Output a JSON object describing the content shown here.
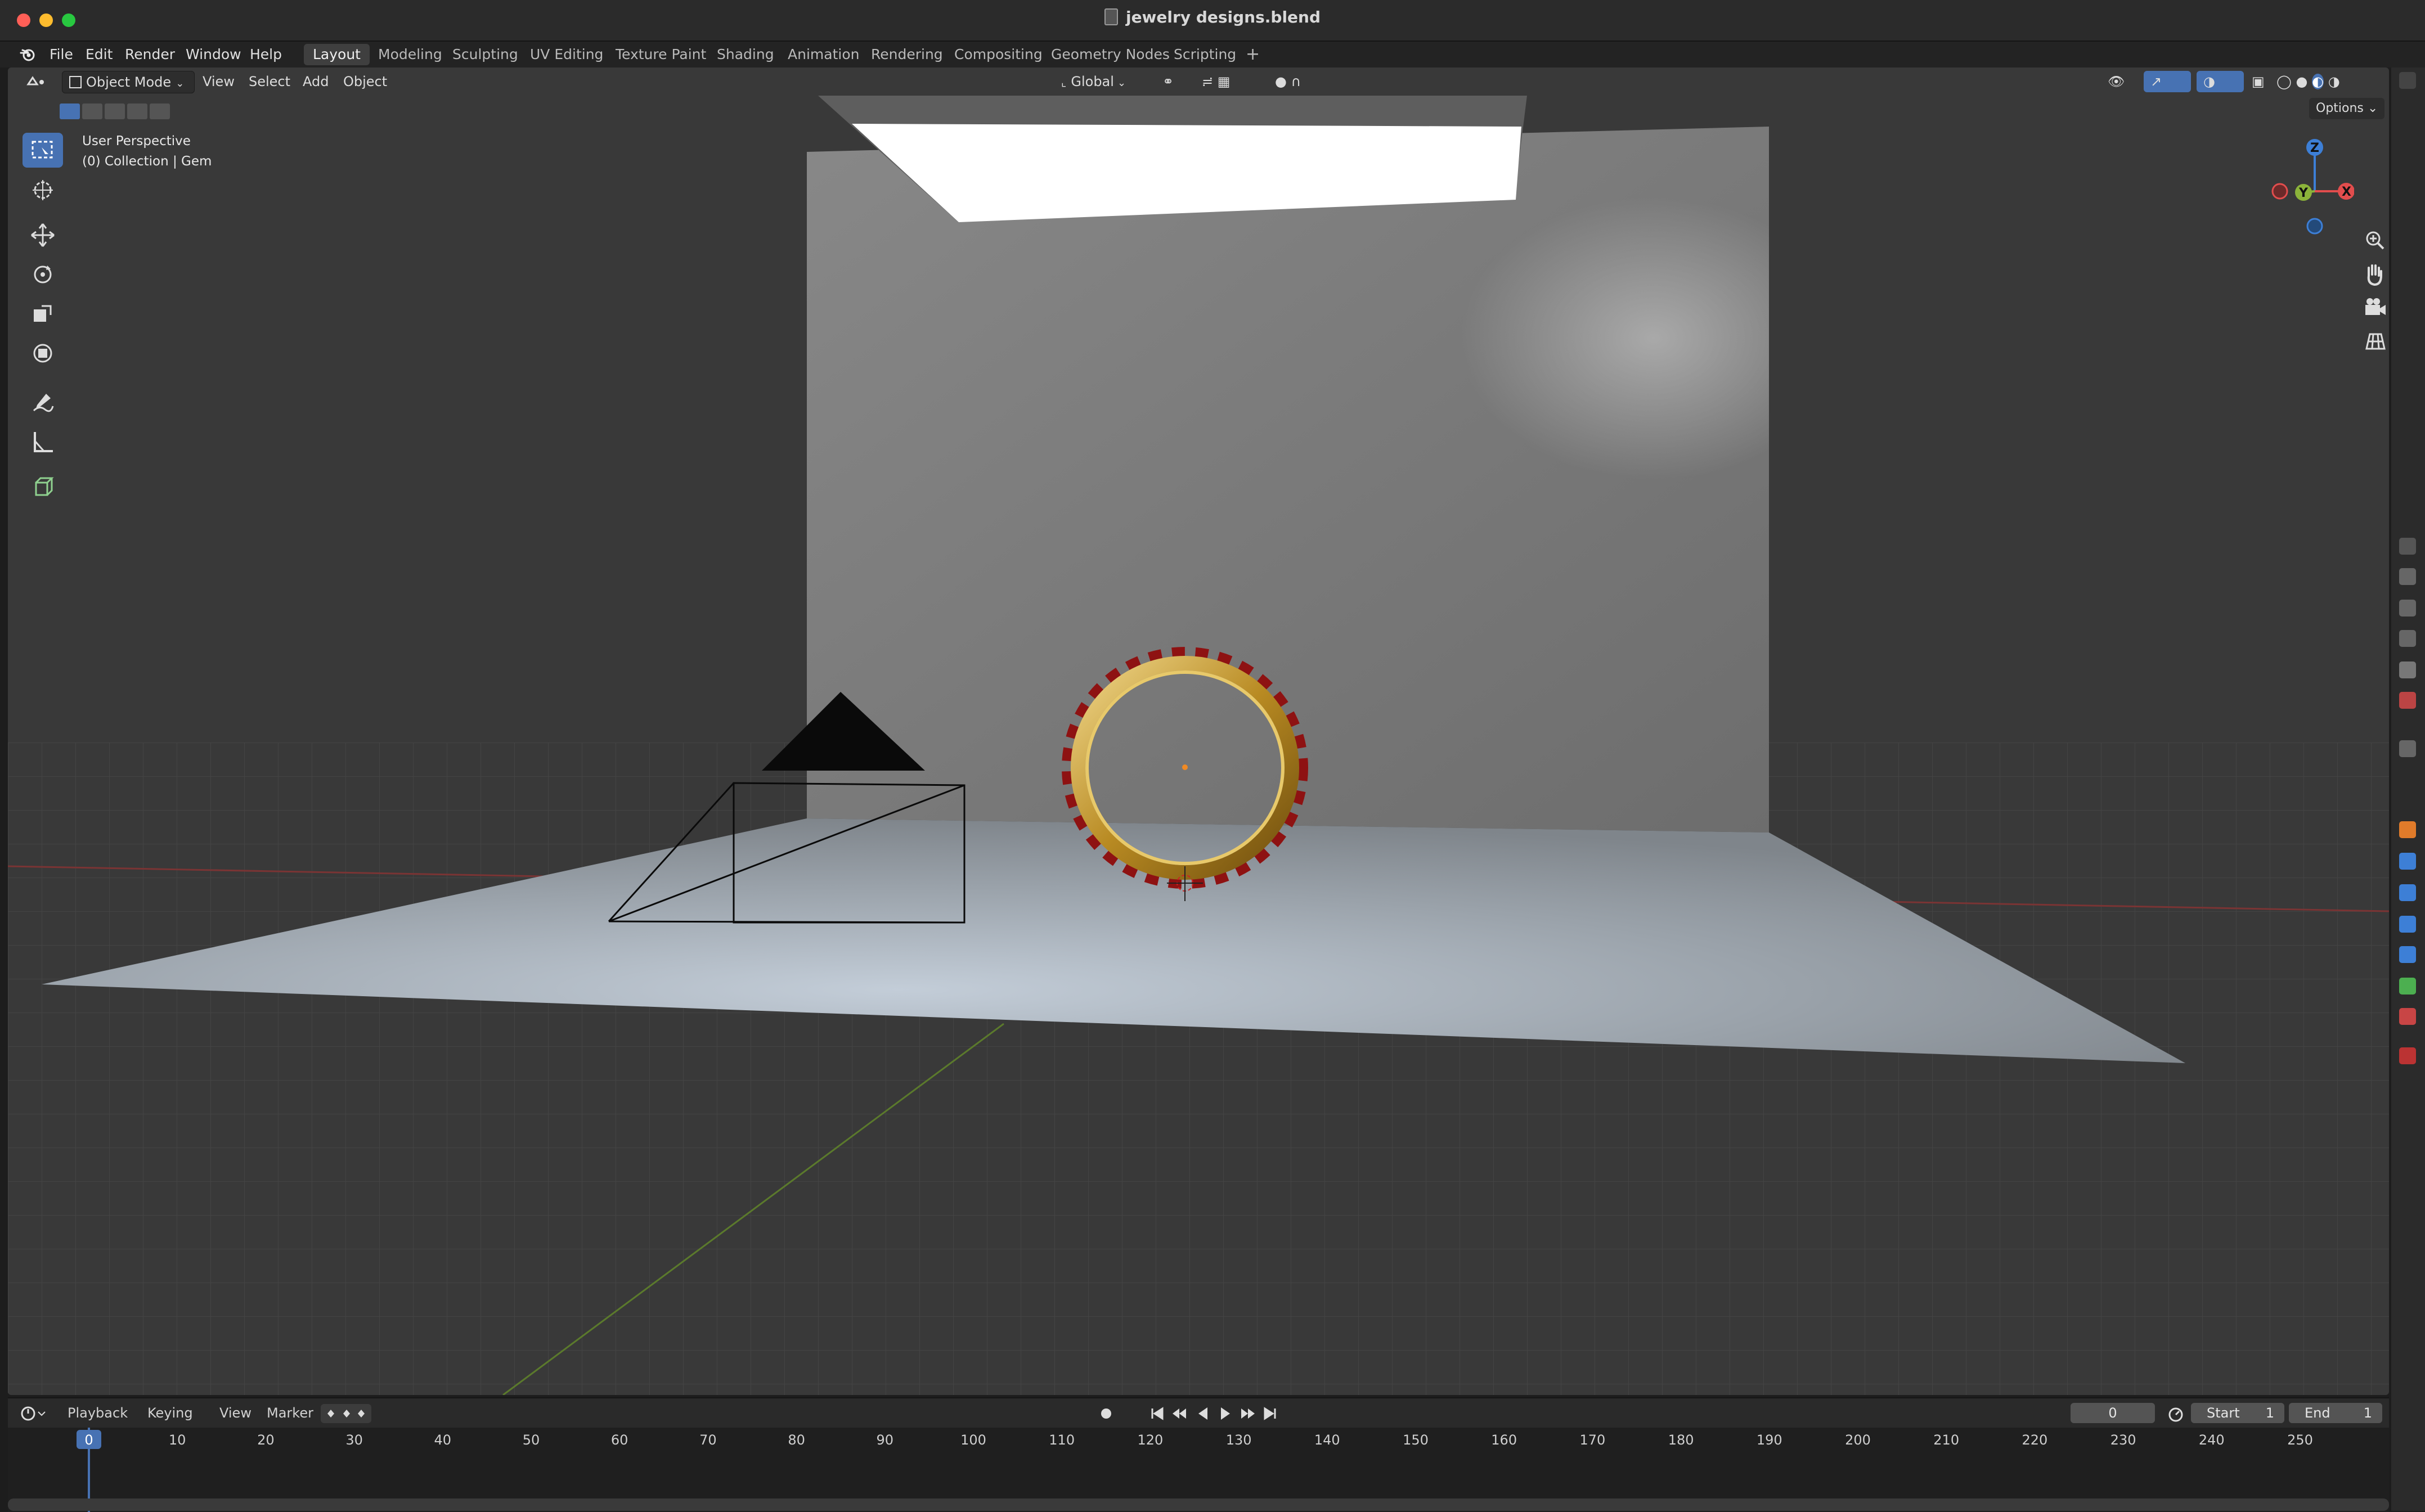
{
  "window": {
    "title": "jewelry designs.blend"
  },
  "menu": {
    "items": [
      "File",
      "Edit",
      "Render",
      "Window",
      "Help"
    ]
  },
  "workspaces": {
    "tabs": [
      "Layout",
      "Modeling",
      "Sculpting",
      "UV Editing",
      "Texture Paint",
      "Shading",
      "Animation",
      "Rendering",
      "Compositing",
      "Geometry Nodes",
      "Scripting"
    ],
    "active": "Layout",
    "add_symbol": "+"
  },
  "viewport_header": {
    "mode": "Object Mode",
    "menus": [
      "View",
      "Select",
      "Add",
      "Object"
    ],
    "transform_orientation": "Global",
    "options_label": "Options"
  },
  "viewport_overlay": {
    "perspective": "User Perspective",
    "collection": "(0) Collection | Gem"
  },
  "gizmo": {
    "z": "Z",
    "x": "X",
    "y": "Y"
  },
  "toolbar": {
    "tools": [
      "select-box",
      "cursor",
      "move",
      "rotate",
      "scale",
      "transform",
      "annotate",
      "measure",
      "add-cube"
    ],
    "active": "select-box"
  },
  "timeline": {
    "menus": [
      "Playback",
      "Keying",
      "View",
      "Marker"
    ],
    "current_frame": "0",
    "start_label": "Start",
    "start_value": "1",
    "end_label": "End",
    "end_value": "1",
    "ticks": [
      "0",
      "10",
      "20",
      "30",
      "40",
      "50",
      "60",
      "70",
      "80",
      "90",
      "100",
      "110",
      "120",
      "130",
      "140",
      "150",
      "160",
      "170",
      "180",
      "190",
      "200",
      "210",
      "220",
      "230",
      "240",
      "250"
    ]
  },
  "colors": {
    "accent": "#4772b3",
    "gizmo_x": "#e24d4d",
    "gizmo_y": "#8bb33a",
    "gizmo_z": "#3d7fd6",
    "ring_gold": "#c9a43a",
    "gem_red": "#8e1212"
  }
}
